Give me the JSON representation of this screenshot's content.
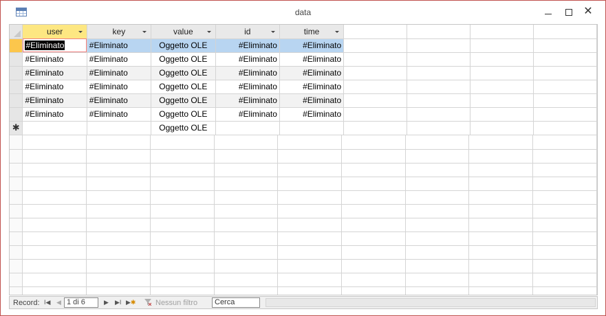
{
  "window": {
    "title": "data",
    "minimize_glyph": "",
    "close_glyph": "✕"
  },
  "sheet": {
    "columns": [
      "user",
      "key",
      "value",
      "id",
      "time"
    ],
    "rows": [
      [
        "#Eliminato",
        "#Eliminato",
        "Oggetto OLE",
        "#Eliminato",
        "#Eliminato"
      ],
      [
        "#Eliminato",
        "#Eliminato",
        "Oggetto OLE",
        "#Eliminato",
        "#Eliminato"
      ],
      [
        "#Eliminato",
        "#Eliminato",
        "Oggetto OLE",
        "#Eliminato",
        "#Eliminato"
      ],
      [
        "#Eliminato",
        "#Eliminato",
        "Oggetto OLE",
        "#Eliminato",
        "#Eliminato"
      ],
      [
        "#Eliminato",
        "#Eliminato",
        "Oggetto OLE",
        "#Eliminato",
        "#Eliminato"
      ],
      [
        "#Eliminato",
        "#Eliminato",
        "Oggetto OLE",
        "#Eliminato",
        "#Eliminato"
      ]
    ],
    "new_row": [
      "",
      "",
      "Oggetto OLE",
      "",
      ""
    ],
    "new_row_marker": "✱"
  },
  "navigation": {
    "record_label": "Record:",
    "first_glyph": "I◀",
    "prev_glyph": "◀",
    "position": "1 di 6",
    "next_glyph": "▶",
    "last_glyph": "▶I",
    "new_glyph": "▶",
    "new_star": "✱",
    "filter_label": "Nessun filtro",
    "search_value": "Cerca"
  },
  "colors": {
    "active_header": "#fde782",
    "current_row_selector": "#fcc64c",
    "selected_row": "#b8d5f1",
    "window_border": "#c0504d"
  },
  "icons": {
    "title": "datasheet-icon",
    "filter": "filter-off-icon"
  }
}
